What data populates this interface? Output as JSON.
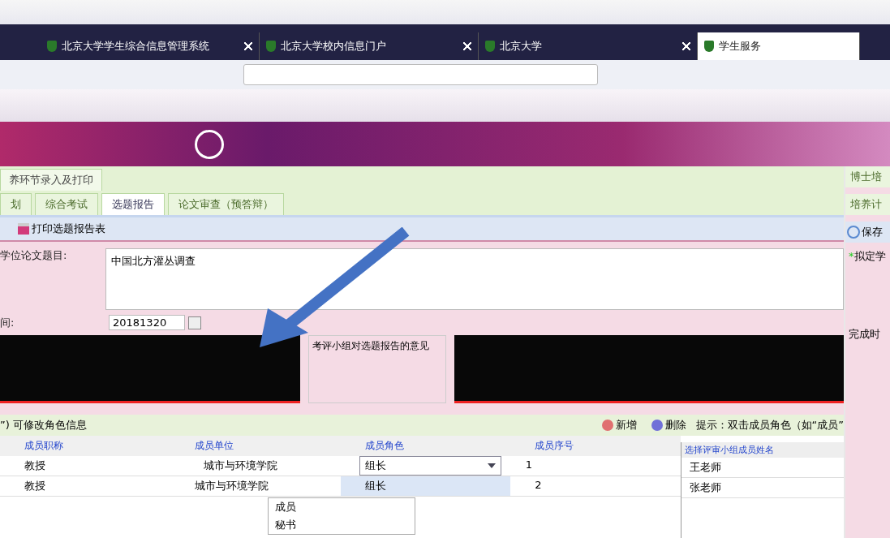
{
  "browser_tabs": [
    {
      "label": "北京大学学生综合信息管理系统",
      "selected": false
    },
    {
      "label": "北京大学校内信息门户",
      "selected": false
    },
    {
      "label": "北京大学",
      "selected": false
    },
    {
      "label": "学生服务",
      "selected": true
    }
  ],
  "main_panel": {
    "title": "养环节录入及打印",
    "tabs": [
      {
        "label": "划",
        "selected": false
      },
      {
        "label": "综合考试",
        "selected": false
      },
      {
        "label": "选题报告",
        "selected": true
      },
      {
        "label": "论文审查（预答辩）",
        "selected": false
      }
    ],
    "toolbar_button": "打印选题报告表",
    "thesis_title_label": "学位论文题目:",
    "thesis_title": "中国北方灌丛调查",
    "date_label": "间:",
    "date_value": "20181320",
    "opinion_label": "考评小组对选题报告的意见",
    "members_hint": "”) 可修改角色信息",
    "add_button": "新增",
    "delete_button": "删除",
    "tip": "提示：双击成员角色（如“成员”",
    "columns": [
      "成员职称",
      "成员单位",
      "成员角色",
      "成员序号"
    ],
    "rows": [
      {
        "title": "教授",
        "unit": "城市与环境学院",
        "role": "组长",
        "order": "1",
        "editing": true
      },
      {
        "title": "教授",
        "unit": "城市与环境学院",
        "role": "组长",
        "order": "2",
        "editing": false
      }
    ],
    "role_options": [
      "成员",
      "秘书"
    ],
    "picker_header": "选择评审小组成员姓名",
    "picker_items": [
      "王老师",
      "张老师"
    ]
  },
  "side_panel": {
    "title": "博士培",
    "tab": "培养计",
    "save_button": "保存",
    "required_mark": "*",
    "field_label": "拟定学",
    "time_label": "完成时"
  }
}
